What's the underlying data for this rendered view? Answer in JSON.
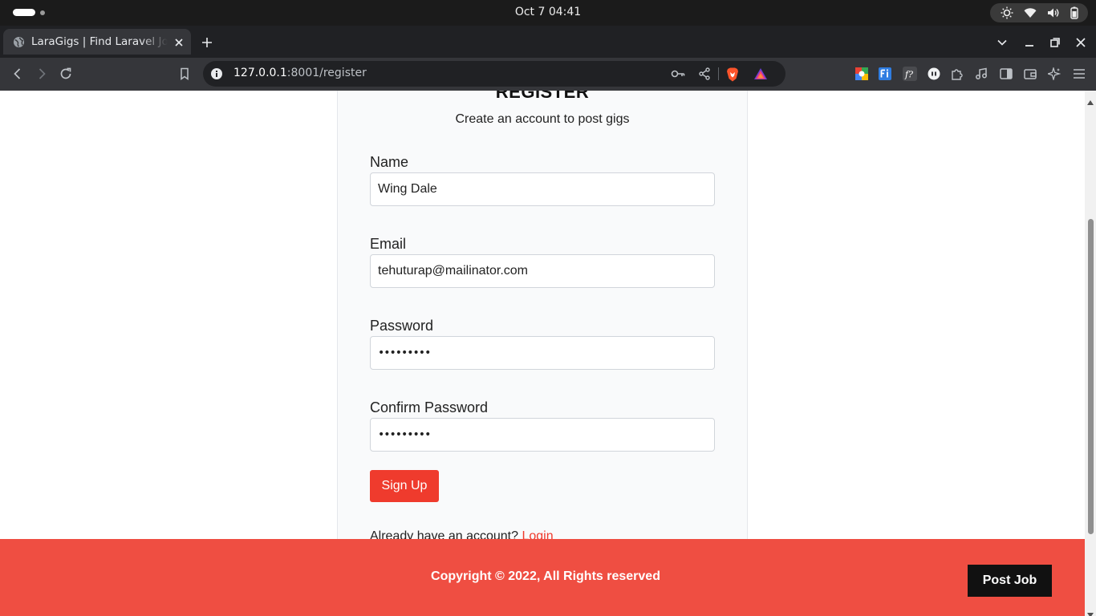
{
  "system": {
    "clock": "Oct 7  04:41"
  },
  "browser": {
    "tab_title": "LaraGigs | Find Laravel Jobs & Projects",
    "url_host": "127.0.0.1",
    "url_path": ":8001/register"
  },
  "form": {
    "heading": "REGISTER",
    "subtitle": "Create an account to post gigs",
    "fields": [
      {
        "label": "Name",
        "value": "Wing Dale",
        "type": "text"
      },
      {
        "label": "Email",
        "value": "tehuturap@mailinator.com",
        "type": "text"
      },
      {
        "label": "Password",
        "value": "•••••••••",
        "type": "password"
      },
      {
        "label": "Confirm Password",
        "value": "•••••••••",
        "type": "password"
      }
    ],
    "submit_label": "Sign Up",
    "login_prompt": "Already have an account?",
    "login_link": "Login"
  },
  "footer": {
    "copyright": "Copyright © 2022, All Rights reserved",
    "post_job_label": "Post Job"
  },
  "colors": {
    "accent": "#ef3b2d",
    "footer_bg": "#ef4e42",
    "card_bg": "#f9fafb"
  }
}
